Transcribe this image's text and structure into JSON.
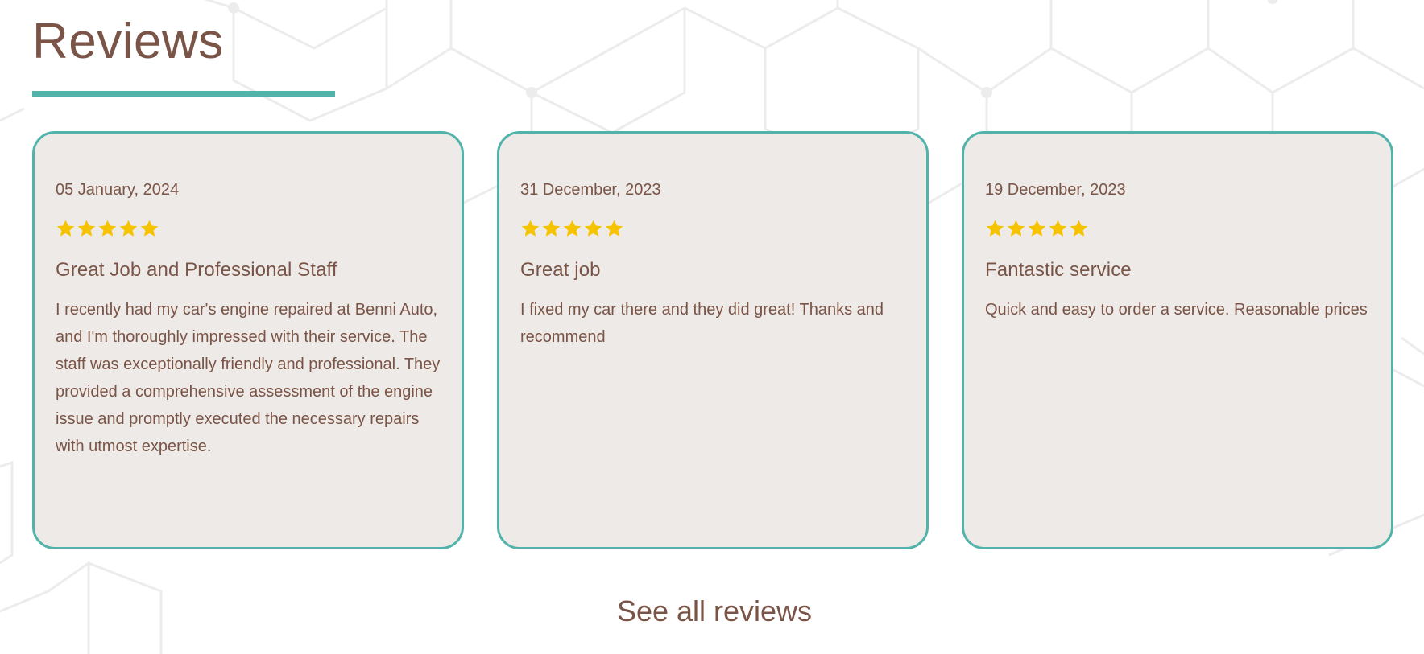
{
  "section": {
    "title": "Reviews"
  },
  "colors": {
    "accent": "#52b3aa",
    "text": "#7a5446",
    "card_background": "#eeeae7",
    "star": "#f7c200"
  },
  "reviews": [
    {
      "date": "05 January, 2024",
      "rating": 5,
      "title": "Great Job and Professional Staff",
      "text": "I recently had my car's engine repaired at Benni Auto, and I'm thoroughly impressed with their service. The staff was exceptionally friendly and professional. They provided a comprehensive assessment of the engine issue and promptly executed the necessary repairs with utmost expertise."
    },
    {
      "date": "31 December, 2023",
      "rating": 5,
      "title": "Great job",
      "text": "I fixed my car there and they did great! Thanks and recommend"
    },
    {
      "date": "19 December, 2023",
      "rating": 5,
      "title": "Fantastic service",
      "text": "Quick and easy to order a service. Reasonable prices"
    }
  ],
  "see_all_label": "See all reviews",
  "icons": {
    "star": "star-icon"
  }
}
